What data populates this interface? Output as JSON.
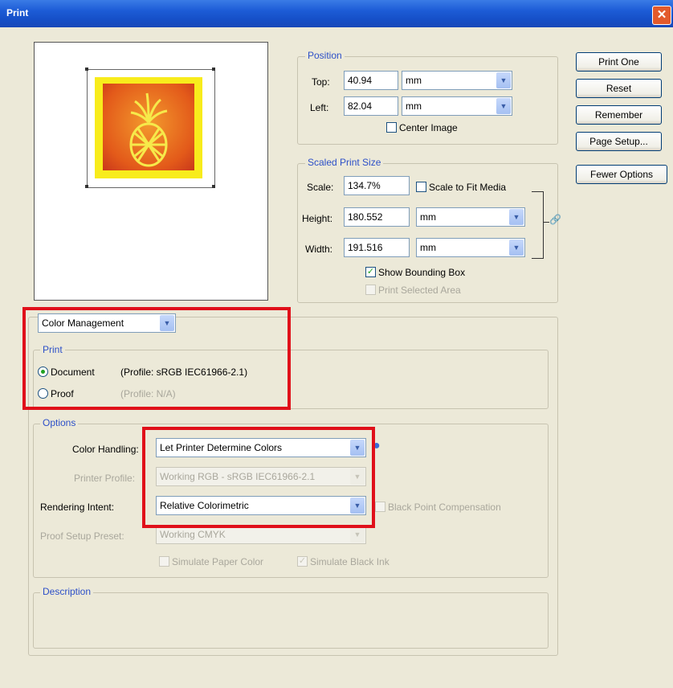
{
  "window": {
    "title": "Print",
    "close_glyph": "✕"
  },
  "buttons": {
    "print_one": "Print One",
    "reset": "Reset",
    "remember": "Remember",
    "page_setup": "Page Setup...",
    "fewer_options": "Fewer Options"
  },
  "position": {
    "legend": "Position",
    "top_label": "Top:",
    "top_value": "40.94",
    "top_unit": "mm",
    "left_label": "Left:",
    "left_value": "82.04",
    "left_unit": "mm",
    "center_image_label": "Center Image",
    "center_image_checked": false
  },
  "scaled": {
    "legend": "Scaled Print Size",
    "scale_label": "Scale:",
    "scale_value": "134.7%",
    "scale_to_fit_label": "Scale to Fit Media",
    "height_label": "Height:",
    "height_value": "180.552",
    "height_unit": "mm",
    "width_label": "Width:",
    "width_value": "191.516",
    "width_unit": "mm",
    "show_bounding_box_label": "Show Bounding Box",
    "show_bounding_box_checked": true,
    "print_selected_area_label": "Print Selected Area"
  },
  "section_select": "Color Management",
  "print_group": {
    "legend": "Print",
    "document_label": "Document",
    "document_profile": "(Profile: sRGB IEC61966-2.1)",
    "proof_label": "Proof",
    "proof_profile": "(Profile: N/A)",
    "selected": "document"
  },
  "options": {
    "legend": "Options",
    "color_handling_label": "Color Handling:",
    "color_handling_value": "Let Printer Determine Colors",
    "printer_profile_label": "Printer Profile:",
    "printer_profile_value": "Working RGB - sRGB IEC61966-2.1",
    "rendering_intent_label": "Rendering Intent:",
    "rendering_intent_value": "Relative Colorimetric",
    "black_point_label": "Black Point Compensation",
    "proof_setup_label": "Proof Setup Preset:",
    "proof_setup_value": "Working CMYK",
    "simulate_paper_label": "Simulate Paper Color",
    "simulate_black_label": "Simulate Black Ink"
  },
  "description": {
    "legend": "Description"
  },
  "colors": {
    "highlight": "#e0101a",
    "title_bar": "#1c5bd6",
    "legend_text": "#2d50c8"
  }
}
